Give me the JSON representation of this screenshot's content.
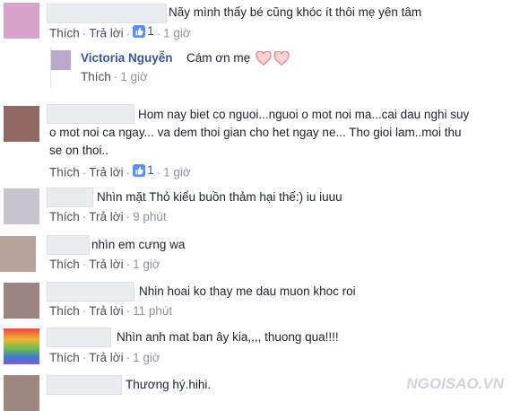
{
  "labels": {
    "like": "Thích",
    "reply": "Trả lời"
  },
  "comments": [
    {
      "text": "Nãy mình thấy bé cũng khóc ít thôi mẹ yên tâm",
      "likes": "1",
      "time": "1 giờ",
      "avatar_color": "#d7a3c8"
    },
    {
      "name": "Victoria Nguyễn",
      "text": "Cám ơn mẹ",
      "time": "1 giờ",
      "avatar_color": "#b7a9c8"
    },
    {
      "text": "Hom nay biet co nguoi...nguoi o mot noi ma...cai dau nghi suy o mot noi ca ngay... va dem thoi gian cho het ngay ne... Tho gioi lam..moi thu se on thoi..",
      "likes": "1",
      "time": "1 giờ",
      "avatar_color": "#8f6a62"
    },
    {
      "text": "Nhìn mặt Thỏ kiểu buồn thảm hại thế:) iu iuuu",
      "time": "9 phút",
      "avatar_color": "#c8c3cc"
    },
    {
      "text": "nhìn em cưng wa",
      "time": "1 giờ",
      "avatar_color": "#b8a39a"
    },
    {
      "text": "Nhin hoai ko thay me dau muon khoc roi",
      "time": "11 phút",
      "avatar_color": "#9a8582"
    },
    {
      "text": "Nhìn anh mat ban ây kia,,,, thuong qua!!!!",
      "time": "1 giờ",
      "avatar_color": "gradient"
    },
    {
      "text": "Thương hý.hihi.",
      "avatar_color": "#9c8880"
    }
  ],
  "watermark": "NGOISAO.VN"
}
